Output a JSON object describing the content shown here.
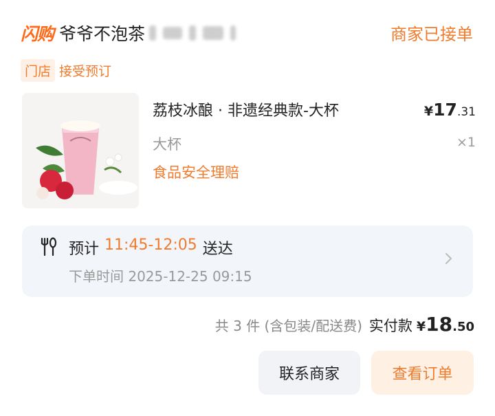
{
  "header": {
    "logo": "闪购",
    "shop_name": "爷爷不泡茶",
    "status": "商家已接单"
  },
  "tags": {
    "store": "门店",
    "preorder": "接受预订"
  },
  "product": {
    "name": "荔枝冰酿 · 非遗经典款-大杯",
    "price_currency": "¥",
    "price_int": "17",
    "price_cents": ".31",
    "spec": "大杯",
    "qty": "×1",
    "insurance": "食品安全理赔",
    "image_icon": "lychee-drink-image"
  },
  "delivery": {
    "prefix": "预计",
    "time_range": "11:45-12:05",
    "suffix": "送达",
    "order_time": "下单时间 2025-12-25 09:15"
  },
  "summary": {
    "count_text": "共 3 件 (含包装/配送费)",
    "pay_label": "实付款",
    "pay_currency": "¥",
    "pay_int": "18",
    "pay_cents": ".50"
  },
  "buttons": {
    "contact": "联系商家",
    "view_order": "查看订单"
  },
  "colors": {
    "accent": "#f07b2c",
    "box_bg": "#f2f5fa",
    "muted": "#999999"
  }
}
